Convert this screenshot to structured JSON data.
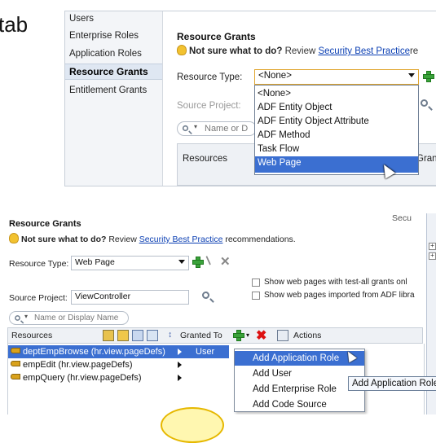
{
  "slide": {
    "word_fragment": "tab"
  },
  "top": {
    "sidebar": {
      "items": [
        "Users",
        "Enterprise Roles",
        "Application Roles",
        "Resource Grants",
        "Entitlement Grants"
      ],
      "selected_index": 3
    },
    "title": "Resource Grants",
    "tip": {
      "bold": "Not sure what to do?",
      "pre": "Review",
      "link": "Security Best Practice",
      "post": "re"
    },
    "resource_type": {
      "label": "Resource Type:",
      "value": "<None>"
    },
    "source_project": {
      "label": "Source Project:"
    },
    "search_placeholder": "Name or D",
    "columns": {
      "resources": "Resources",
      "granted_partial": "Gran"
    },
    "dropdown": {
      "options": [
        "<None>",
        "ADF Entity Object",
        "ADF Entity Object Attribute",
        "ADF Method",
        "Task Flow",
        "Web Page"
      ],
      "selected_index": 5
    }
  },
  "bottom": {
    "title": "Resource Grants",
    "right_label": "Secu",
    "tip": {
      "bold": "Not sure what to do?",
      "pre": "Review",
      "link": "Security Best Practice",
      "post": "recommendations."
    },
    "resource_type": {
      "label": "Resource Type:",
      "value": "Web Page"
    },
    "source_project": {
      "label": "Source Project:",
      "value": "ViewController"
    },
    "checkbox1": "Show web pages with test-all grants onl",
    "checkbox2": "Show web pages imported from ADF libra",
    "search_placeholder": "Name or Display Name",
    "toolbar": {
      "resources": "Resources",
      "granted_to": "Granted To",
      "actions": "Actions"
    },
    "rows": [
      {
        "name": "deptEmpBrowse (hr.view.pageDefs)",
        "granted": "User",
        "selected": true
      },
      {
        "name": "empEdit (hr.view.pageDefs)",
        "granted": "",
        "selected": false
      },
      {
        "name": "empQuery (hr.view.pageDefs)",
        "granted": "",
        "selected": false
      }
    ],
    "menu": {
      "items": [
        "Add Application Role",
        "Add User",
        "Add Enterprise Role",
        "Add Code Source"
      ],
      "highlighted_index": 0
    },
    "tooltip": "Add Application Role"
  },
  "colors": {
    "selection": "#3b6fd1",
    "link": "#0b3fb3",
    "highlight_border": "#e0a52e"
  }
}
